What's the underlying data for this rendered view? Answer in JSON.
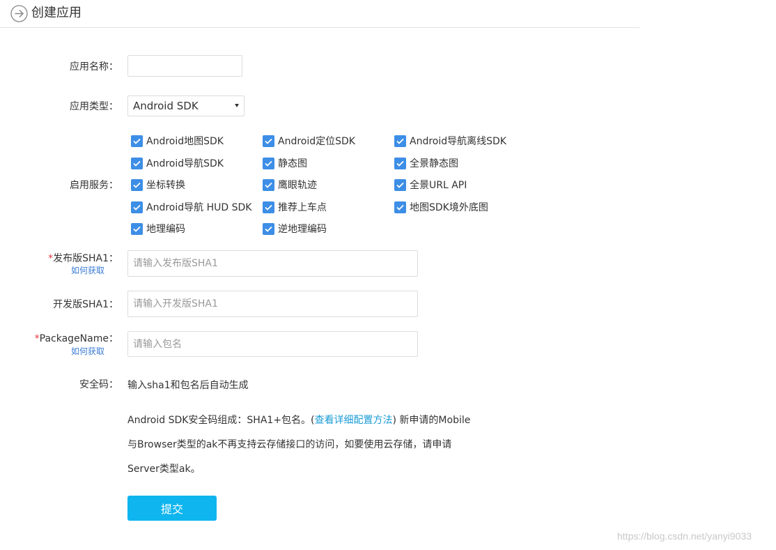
{
  "header": {
    "title": "创建应用",
    "back_icon": "circle-arrow-right-icon"
  },
  "form": {
    "app_name": {
      "label": "应用名称：",
      "value": ""
    },
    "app_type": {
      "label": "应用类型：",
      "selected": "Android SDK"
    },
    "services": {
      "label": "启用服务：",
      "items": [
        {
          "label": "Android地图SDK",
          "checked": true
        },
        {
          "label": "Android定位SDK",
          "checked": true
        },
        {
          "label": "Android导航离线SDK",
          "checked": true
        },
        {
          "label": "Android导航SDK",
          "checked": true
        },
        {
          "label": "静态图",
          "checked": true
        },
        {
          "label": "全景静态图",
          "checked": true
        },
        {
          "label": "坐标转换",
          "checked": true
        },
        {
          "label": "鹰眼轨迹",
          "checked": true
        },
        {
          "label": "全景URL API",
          "checked": true
        },
        {
          "label": "Android导航 HUD SDK",
          "checked": true
        },
        {
          "label": "推荐上车点",
          "checked": true
        },
        {
          "label": "地图SDK境外底图",
          "checked": true
        },
        {
          "label": "地理编码",
          "checked": true
        },
        {
          "label": "逆地理编码",
          "checked": true
        }
      ]
    },
    "release_sha1": {
      "required_mark": "*",
      "label": "发布版SHA1：",
      "help": "如何获取",
      "placeholder": "请输入发布版SHA1"
    },
    "dev_sha1": {
      "label": "开发版SHA1：",
      "placeholder": "请输入开发版SHA1"
    },
    "package_name": {
      "required_mark": "*",
      "label": "PackageName：",
      "help": "如何获取",
      "placeholder": "请输入包名"
    },
    "security_code": {
      "label": "安全码：",
      "value": "输入sha1和包名后自动生成"
    },
    "info": {
      "line1_prefix": "Android SDK安全码组成：SHA1+包名。(",
      "line1_link": "查看详细配置方法",
      "line1_suffix": ") 新申请的Mobile",
      "line2": "与Browser类型的ak不再支持云存储接口的访问，如要使用云存储，请申请",
      "line3": "Server类型ak。"
    },
    "submit_label": "提交"
  },
  "watermark": "https://blog.csdn.net/yanyi9033",
  "colors": {
    "accent": "#0fb5ee",
    "checkbox": "#3d8ee6",
    "required": "#e4393c",
    "link": "#1a9cd6"
  }
}
